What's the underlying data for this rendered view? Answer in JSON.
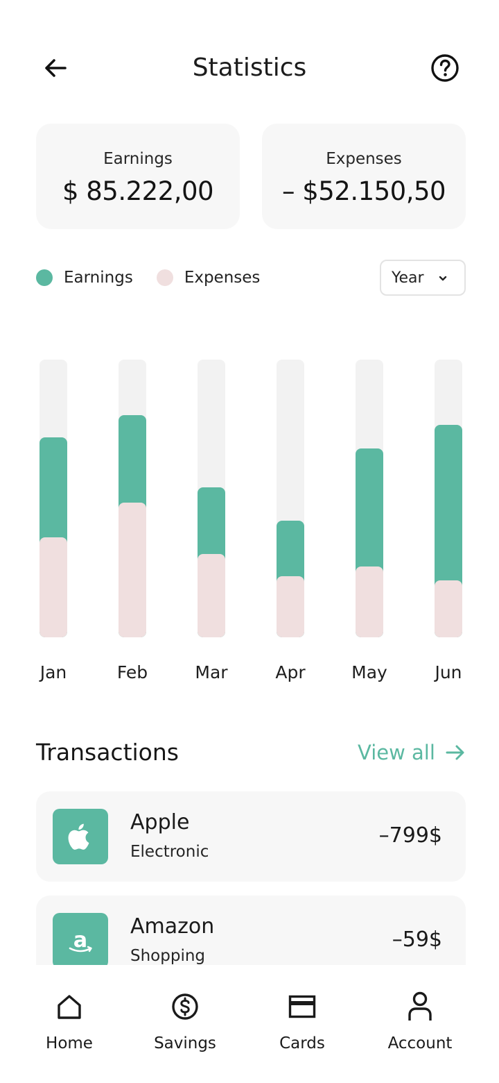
{
  "header": {
    "title": "Statistics",
    "back_icon": "arrow-left-icon",
    "help_icon": "question-circle-icon"
  },
  "summary": {
    "earnings_label": "Earnings",
    "earnings_value": "$ 85.222,00",
    "expenses_label": "Expenses",
    "expenses_value": "– $52.150,50"
  },
  "legend": {
    "earnings": "Earnings",
    "expenses": "Expenses"
  },
  "period_select": {
    "value": "Year"
  },
  "colors": {
    "accent": "#5bb8a1",
    "expense": "#f0dfdf",
    "track": "#f2f2f2"
  },
  "chart_data": {
    "type": "bar",
    "categories": [
      "Jan",
      "Feb",
      "Mar",
      "Apr",
      "May",
      "Jun"
    ],
    "series": [
      {
        "name": "Earnings",
        "values": [
          72,
          80,
          54,
          42,
          68,
          76.5
        ]
      },
      {
        "name": "Expenses",
        "values": [
          36,
          48.5,
          30,
          22,
          25.5,
          20.5
        ]
      }
    ],
    "ylim": [
      0,
      100
    ],
    "stacked": false,
    "grid": false,
    "legend": "top-left"
  },
  "transactions": {
    "title": "Transactions",
    "view_all": "View all",
    "items": [
      {
        "name": "Apple",
        "category": "Electronic",
        "amount": "–799$",
        "icon": "apple-icon"
      },
      {
        "name": "Amazon",
        "category": "Shopping",
        "amount": "–59$",
        "icon": "amazon-icon"
      }
    ]
  },
  "nav": {
    "items": [
      {
        "label": "Home",
        "icon": "home-icon"
      },
      {
        "label": "Savings",
        "icon": "dollar-circle-icon"
      },
      {
        "label": "Cards",
        "icon": "card-icon"
      },
      {
        "label": "Account",
        "icon": "user-icon"
      }
    ]
  }
}
